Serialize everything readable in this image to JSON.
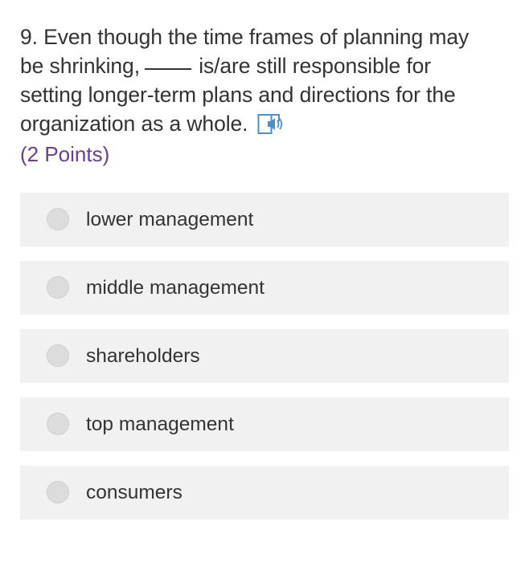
{
  "question": {
    "line1": "9. Even though the time frames of planning may",
    "line2_before": "be shrinking,",
    "line2_after": "is/are still responsible for",
    "line3": "setting longer-term plans and directions for the",
    "line4": "organization as a whole.",
    "speaker_icon": "immersive-reader-speaker-icon",
    "points": "(2 Points)"
  },
  "options": [
    {
      "label": "lower management",
      "selected": false
    },
    {
      "label": "middle management",
      "selected": false
    },
    {
      "label": "shareholders",
      "selected": false
    },
    {
      "label": "top management",
      "selected": false
    },
    {
      "label": "consumers",
      "selected": false
    }
  ],
  "colors": {
    "text": "#333333",
    "points": "#6a3f8f",
    "option_bg": "#f1f1f1",
    "radio": "#dcdcdc",
    "speaker_icon": "#4a90c8"
  }
}
